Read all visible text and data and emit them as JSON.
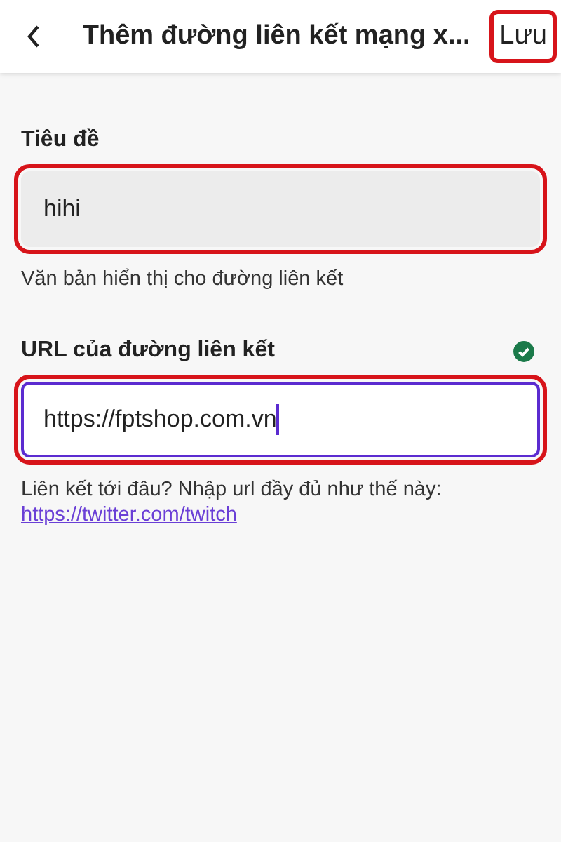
{
  "header": {
    "title": "Thêm đường liên kết mạng x...",
    "save_button": {
      "label": "Lưu",
      "highlighted": true
    }
  },
  "fields": [
    {
      "label": "Tiêu đề",
      "value": "hihi",
      "focused": false,
      "valid": false,
      "highlighted": true,
      "helper": "Văn bản hiển thị cho đường liên kết"
    },
    {
      "label": "URL của đường liên kết",
      "value": "https://fptshop.com.vn",
      "focused": true,
      "valid": true,
      "highlighted": true,
      "helper": "Liên kết tới đâu? Nhập url đầy đủ như thế này:",
      "helper_link": "https://twitter.com/twitch"
    }
  ]
}
